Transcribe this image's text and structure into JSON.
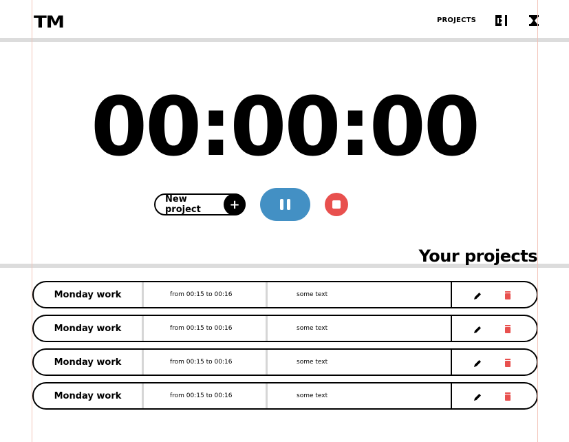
{
  "header": {
    "logo": "TM",
    "nav_projects": "PROJECTS",
    "icons": [
      "logout-icon",
      "hourglass-icon"
    ]
  },
  "timer": {
    "display": "00:00:00"
  },
  "controls": {
    "new_project_label": "New project",
    "new_project_icon": "plus-icon",
    "pause_icon": "pause-icon",
    "stop_icon": "stop-icon",
    "colors": {
      "pause": "#4390c4",
      "stop": "#e8504e"
    }
  },
  "projects_section": {
    "title": "Your projects"
  },
  "projects": [
    {
      "name": "Monday work",
      "time": "from 00:15 to 00:16",
      "note": "some text"
    },
    {
      "name": "Monday work",
      "time": "from 00:15 to 00:16",
      "note": "some text"
    },
    {
      "name": "Monday work",
      "time": "from 00:15 to 00:16",
      "note": "some text"
    },
    {
      "name": "Monday work",
      "time": "from 00:15 to 00:16",
      "note": "some text"
    }
  ],
  "row_actions": {
    "edit_icon": "pencil-icon",
    "delete_icon": "trash-icon",
    "delete_color": "#e8504e"
  }
}
